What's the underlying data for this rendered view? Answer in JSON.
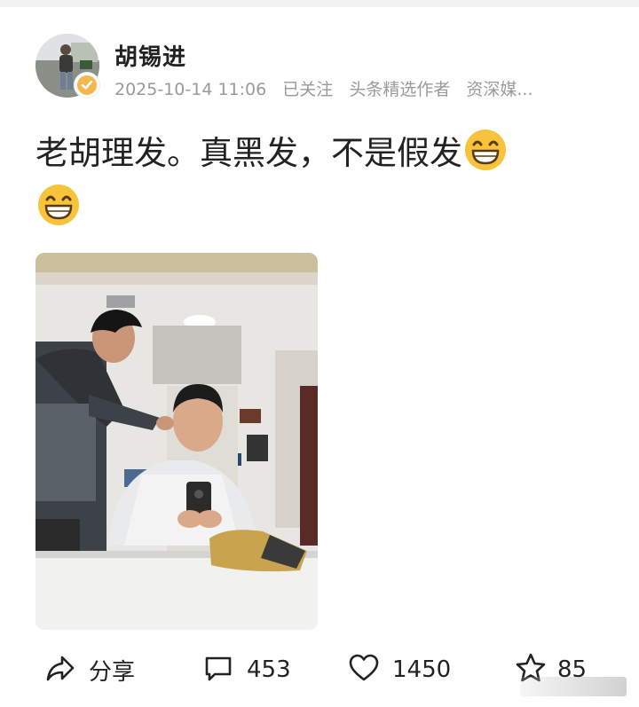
{
  "post": {
    "author_name": "胡锡进",
    "timestamp": "2025-10-14 11:06",
    "follow_status": "已关注",
    "badge_1": "头条精选作者",
    "badge_2": "资深媒...",
    "text": "老胡理发。真黑发，不是假发"
  },
  "actions": {
    "share_label": "分享",
    "comment_count": "453",
    "like_count": "1450",
    "favorite_count": "85"
  },
  "colors": {
    "text": "#222222",
    "meta": "#9a9a9a",
    "emoji": "#f7c33b"
  },
  "icons": [
    "share-icon",
    "comment-icon",
    "heart-icon",
    "star-icon",
    "grin-emoji-icon",
    "verified-badge-icon"
  ]
}
